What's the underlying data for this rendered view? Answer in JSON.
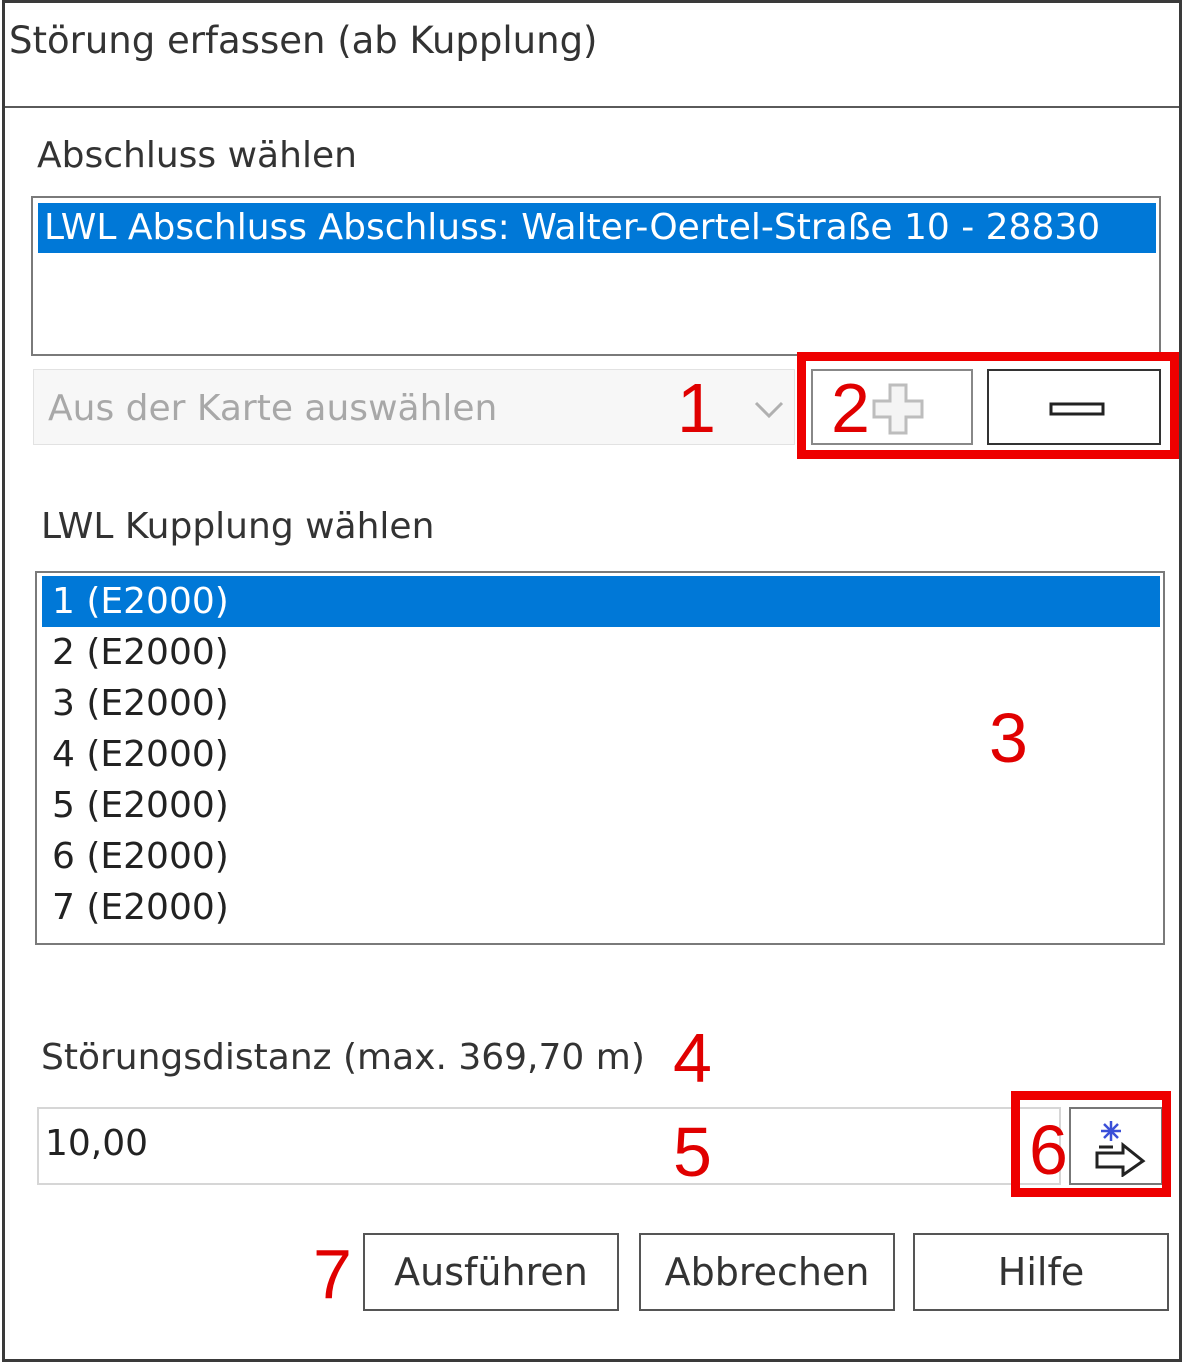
{
  "window": {
    "title": "Störung erfassen (ab Kupplung)"
  },
  "abschluss": {
    "label": "Abschluss wählen",
    "items": [
      {
        "label": "LWL Abschluss Abschluss: Walter-Oertel-Straße 10 - 28830",
        "selected": true
      }
    ],
    "combo_placeholder": "Aus der Karte auswählen"
  },
  "kupplung": {
    "label": "LWL Kupplung wählen",
    "items": [
      {
        "label": "1 (E2000)",
        "selected": true
      },
      {
        "label": "2 (E2000)",
        "selected": false
      },
      {
        "label": "3 (E2000)",
        "selected": false
      },
      {
        "label": "4 (E2000)",
        "selected": false
      },
      {
        "label": "5 (E2000)",
        "selected": false
      },
      {
        "label": "6 (E2000)",
        "selected": false
      },
      {
        "label": "7 (E2000)",
        "selected": false
      }
    ]
  },
  "distance": {
    "label": "Störungsdistanz (max. 369,70 m)",
    "value": "10,00"
  },
  "buttons": {
    "execute": "Ausführen",
    "cancel": "Abbrechen",
    "help": "Hilfe"
  },
  "annotations": [
    "1",
    "2",
    "3",
    "4",
    "5",
    "6",
    "7"
  ],
  "icons": {
    "add": "plus-icon",
    "remove": "minus-icon",
    "pick": "pick-from-map-icon",
    "combo_arrow": "chevron-down-icon"
  },
  "colors": {
    "selection": "#0078d7",
    "annotation": "#ee0000"
  }
}
